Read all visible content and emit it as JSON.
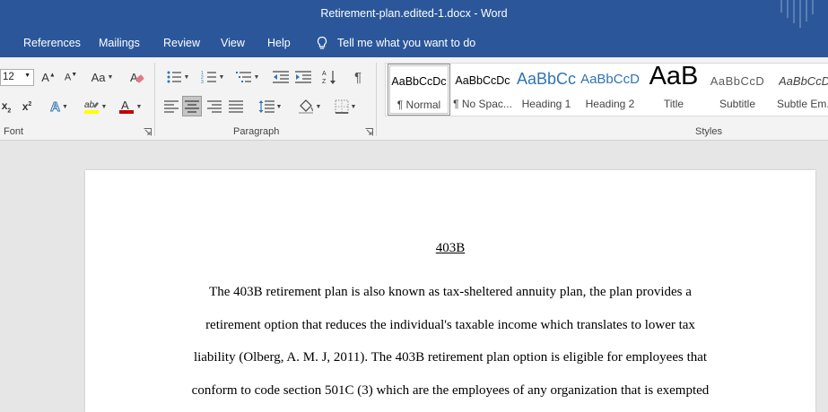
{
  "window": {
    "title": "Retirement-plan.edited-1.docx  -  Word"
  },
  "menu": {
    "references": "References",
    "mailings": "Mailings",
    "review": "Review",
    "view": "View",
    "help": "Help",
    "tell_me": "Tell me what you want to do"
  },
  "font_group": {
    "label": "Font",
    "font_size": "12",
    "change_case": "Aa"
  },
  "paragraph_group": {
    "label": "Paragraph"
  },
  "styles_group": {
    "label": "Styles",
    "items": [
      {
        "preview": "AaBbCcDc",
        "name": "¶ Normal"
      },
      {
        "preview": "AaBbCcDc",
        "name": "¶ No Spac..."
      },
      {
        "preview": "AaBbCc",
        "name": "Heading 1"
      },
      {
        "preview": "AaBbCcD",
        "name": "Heading 2"
      },
      {
        "preview": "AaB",
        "name": "Title"
      },
      {
        "preview": "AaBbCcD",
        "name": "Subtitle"
      },
      {
        "preview": "AaBbCcD",
        "name": "Subtle Em..."
      }
    ]
  },
  "document": {
    "heading": "403B",
    "lines": [
      "The 403B retirement plan is also known as tax-sheltered annuity plan, the plan provides a",
      "retirement option that reduces the individual's taxable income which translates to lower tax",
      "liability (Olberg, A. M. J, 2011). The 403B retirement plan option is eligible for employees that",
      "conform to code section 501C (3) which are the employees of any organization that is exempted"
    ]
  },
  "colors": {
    "accent": "#2b579a",
    "highlight": "#ffff00",
    "font_color": "#c00000"
  }
}
